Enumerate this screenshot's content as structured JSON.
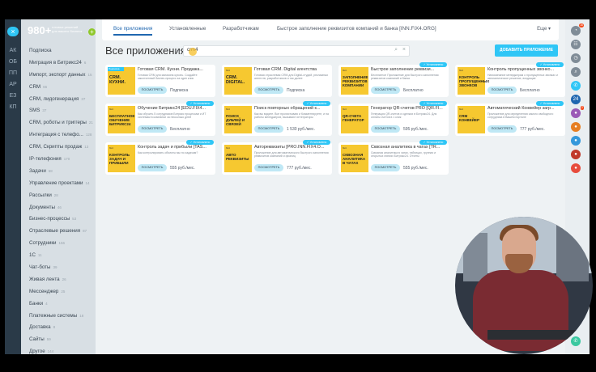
{
  "left_menu": {
    "promo_number": "980+",
    "promo_text": "готовых решений для вашего бизнеса",
    "items": [
      {
        "label": "Подписка",
        "count": ""
      },
      {
        "label": "Миграция в Битрикс24",
        "count": "6"
      },
      {
        "label": "Импорт, экспорт данных",
        "count": "15"
      },
      {
        "label": "CRM",
        "count": "66"
      },
      {
        "label": "CRM, лидогенерация",
        "count": "37"
      },
      {
        "label": "SMS",
        "count": "37"
      },
      {
        "label": "CRM, роботы и триггеры",
        "count": "21"
      },
      {
        "label": "Интеграция с телефо...",
        "count": "128"
      },
      {
        "label": "CRM, Скрипты продаж",
        "count": "13"
      },
      {
        "label": "IP-телефония",
        "count": "170"
      },
      {
        "label": "Задачи",
        "count": "68"
      },
      {
        "label": "Управление проектами",
        "count": "14"
      },
      {
        "label": "Рассылки",
        "count": "28"
      },
      {
        "label": "Документы",
        "count": "46"
      },
      {
        "label": "Бизнес-процессы",
        "count": "53"
      },
      {
        "label": "Отраслевые решения",
        "count": "87"
      },
      {
        "label": "Сотрудники",
        "count": "156"
      },
      {
        "label": "1С",
        "count": "11"
      },
      {
        "label": "Чат-боты",
        "count": "39"
      },
      {
        "label": "Живая лента",
        "count": "26"
      },
      {
        "label": "Мессенджер",
        "count": "25"
      },
      {
        "label": "Банки",
        "count": "4"
      },
      {
        "label": "Платежные системы",
        "count": "18"
      },
      {
        "label": "Доставка",
        "count": "8"
      },
      {
        "label": "Сайты",
        "count": "59"
      },
      {
        "label": "Другое",
        "count": "144"
      }
    ]
  },
  "tabs": [
    {
      "label": "Все приложения",
      "active": true
    },
    {
      "label": "Установленные",
      "active": false
    },
    {
      "label": "Разработчикам",
      "active": false
    },
    {
      "label": "Быстрое заполнение реквизитов компаний и банка [INN.FIX4.ORG]",
      "active": false
    }
  ],
  "tabs_more": "Еще ▾",
  "page_title": "Все приложения",
  "search": {
    "query": "crm4"
  },
  "add_app_button": "Добавить приложение",
  "view_button": "Посмотреть",
  "cards": [
    {
      "title": "Готовая CRM. Кухни. Продажа...",
      "desc": "Готовая CRM для магазина кухонь. Создайте законченный бизнес-процесс за один клик",
      "price": "Подписка",
      "thumb": "CRM. Кухни.",
      "badge": "",
      "subscription": "Подписка"
    },
    {
      "title": "Готовая CRM. Digital агентства",
      "desc": "Готовая отраслевая CRM для Digital-студий, рекламных агентств, разработчиков и так далее",
      "price": "Подписка",
      "thumb": "CRM. Digital.",
      "badge": "",
      "subscription": ""
    },
    {
      "title": "Быстрое заполнение реквизи...",
      "desc": "Бесплатное Приложение для быстрого заполнения реквизитов компаний и банка",
      "price": "Бесплатно",
      "thumb": "Заполнение реквизитов компании",
      "badge": "✓ Установлено",
      "subscription": ""
    },
    {
      "title": "Контроль пропущенных звонко...",
      "desc": "Напоминание менеджерам о пропущенных звонках и автоматическое решение, входящие",
      "price": "Бесплатно",
      "thumb": "Контроль пропущенных звонков",
      "badge": "✓ Установлено",
      "subscription": ""
    },
    {
      "title": "Обучение Битрикс24 [EDU.FIX4...",
      "desc": "Как обучить 5 сотрудников Битрикс процессам и ИТ системам в компании за несколько дней",
      "price": "Бесплатно",
      "thumb": "Бесплатное обучение Битрикс24",
      "badge": "✓ Установлено",
      "subscription": ""
    },
    {
      "title": "Поиск повторных обращений к...",
      "desc": "Как вы видите. Все пролистываю и Комментируете, и на работы менеджеров, вызывают интеграторы",
      "price": "1 530 руб./мес.",
      "thumb": "Поиск дублей и связей",
      "badge": "✓ Установлено",
      "subscription": ""
    },
    {
      "title": "Генератор QR-счетов PRO [QR.FI...",
      "desc": "Генерация QR-счетов и сделках в Битрикс24. Для оплаты счетов в 1 клик",
      "price": "595 руб./мес.",
      "thumb": "QR-счета генератор",
      "badge": "✓ Установлено",
      "subscription": ""
    },
    {
      "title": "Автоматический Конвейер загр...",
      "desc": "Приложение для определения самого свободного сотрудника в Вашем портале",
      "price": "777 руб./мес.",
      "thumb": "CRM конвейер",
      "badge": "✓ Установлено",
      "subscription": ""
    },
    {
      "title": "Контроль задач и прибыли [TAS...",
      "desc": "Как контролировать объекты мы по задачам?",
      "price": "555 руб./мес.",
      "thumb": "Контроль задач и прибыли",
      "badge": "✓ Установлено",
      "subscription": ""
    },
    {
      "title": "Автореквизиты [PRO.INN.FIX4.O...",
      "desc": "Приложение для автоматического быстрого заполнения реквизитов компаний и физлиц",
      "price": "777 руб./мес.",
      "thumb": "Авто реквизиты",
      "badge": "✓ Установлено",
      "subscription": ""
    },
    {
      "title": "Сквозная аналитика в чатах [TR...",
      "desc": "Сквозная аналитика в чатах, таблицах, группах и открытых линиях Битрикс24. Отчеты",
      "price": "555 руб./мес.",
      "thumb": "Сквозная аналитика в чатах",
      "badge": "✓ Установлено",
      "subscription": ""
    }
  ],
  "right_panel": [
    {
      "icon": "notification-icon",
      "color": "#7f8c97",
      "badge": "16"
    },
    {
      "icon": "calendar-icon",
      "color": "#7f8c97",
      "badge": ""
    },
    {
      "icon": "timer-icon",
      "color": "#7f8c97",
      "badge": ""
    },
    {
      "icon": "search-icon",
      "color": "#7f8c97",
      "badge": ""
    },
    {
      "icon": "chat-icon",
      "color": "#2fc6f6",
      "badge": ""
    },
    {
      "icon": "bitrix24-icon",
      "color": "#2067b0",
      "badge": ""
    },
    {
      "icon": "avatar-icon",
      "color": "#9b59b6",
      "badge": "2"
    },
    {
      "icon": "avatar-icon-2",
      "color": "#e67e22",
      "badge": ""
    },
    {
      "icon": "avatar-icon-3",
      "color": "#3498db",
      "badge": ""
    },
    {
      "icon": "avatar-icon-4",
      "color": "#c0392b",
      "badge": ""
    },
    {
      "icon": "avatar-icon-5",
      "color": "#e74c3c",
      "badge": ""
    }
  ],
  "colors": {
    "accent": "#2fc6f6",
    "thumb": "#f6c830",
    "sidebar": "#2a3a48"
  }
}
